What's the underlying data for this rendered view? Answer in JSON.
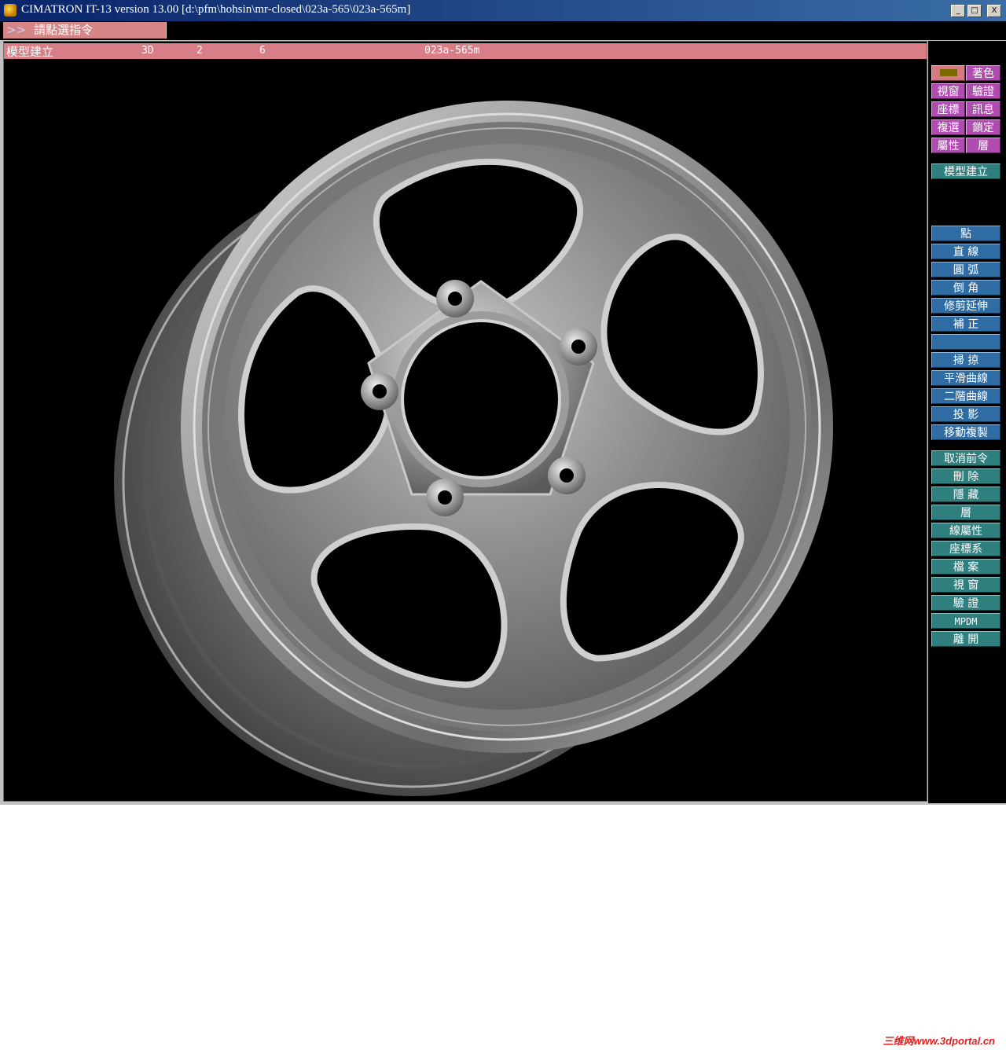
{
  "window": {
    "title": "CIMATRON IT-13 version 13.00 [d:\\pfm\\hohsin\\mr-closed\\023a-565\\023a-565m]",
    "minimize": "_",
    "maximize": "□",
    "close": "X"
  },
  "prompt": {
    "arrows": ">>",
    "text": "請點選指令"
  },
  "status": {
    "mode": "模型建立",
    "view": "3D",
    "field2": "2",
    "field3": "6",
    "filename": "023a-565m"
  },
  "panel": {
    "top_grid": [
      {
        "left": "",
        "right": "著色",
        "left_icon": "color-swatch"
      },
      {
        "left": "視窗",
        "right": "驗證"
      },
      {
        "left": "座標",
        "right": "訊息"
      },
      {
        "left": "複選",
        "right": "鎖定"
      },
      {
        "left": "屬性",
        "right": "層"
      }
    ],
    "module": "模型建立",
    "geometry": [
      "點",
      "直 線",
      "圓 弧",
      "倒 角",
      "修剪延伸",
      "補 正",
      "",
      "掃 掠",
      "平滑曲線",
      "二階曲線",
      "投 影",
      "移動複製"
    ],
    "utilities": [
      "取消前令",
      "刪 除",
      "隱 藏",
      "層",
      "線屬性",
      "座標系",
      "檔 案",
      "視 窗",
      "驗 證",
      "MPDM",
      "離 開"
    ]
  },
  "colors": {
    "title_bar": "#0a246a",
    "prompt_pink": "#d58585",
    "panel_magenta": "#b04bb0",
    "panel_blue": "#2f6ca3",
    "panel_teal": "#2f7f7f",
    "viewport_bg": "#000000"
  },
  "watermark": "三维网www.3dportal.cn"
}
